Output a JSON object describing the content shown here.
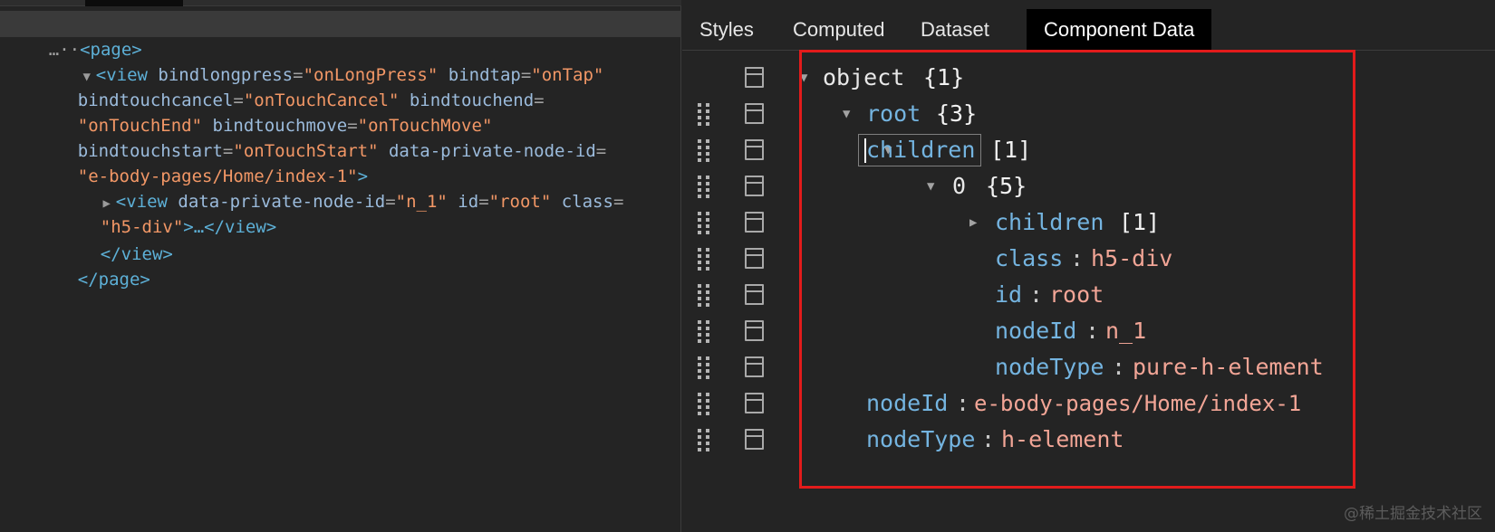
{
  "elements": {
    "lines": [
      {
        "ellipsis": "…",
        "tag_open": "<page>"
      },
      {
        "arrow": "▼",
        "tag_open": "<view ",
        "a1": "bindlongpress",
        "v1": "\"onLongPress\"",
        "a2": "bindtap",
        "v2": "\"onTap\""
      },
      {
        "a1": "bindtouchcancel",
        "v1": "\"onTouchCancel\"",
        "a2": "bindtouchend"
      },
      {
        "v1": "\"onTouchEnd\"",
        "a1": "bindtouchmove",
        "v2": "\"onTouchMove\""
      },
      {
        "a1": "bindtouchstart",
        "v1": "\"onTouchStart\"",
        "a2": "data-private-node-id"
      },
      {
        "v1": "\"e-body-pages/Home/index-1\"",
        "close": ">"
      },
      {
        "arrow": "▶",
        "tag_open": "<view ",
        "a1": "data-private-node-id",
        "v1": "\"n_1\"",
        "a2": "id",
        "v2": "\"root\"",
        "a3": "class"
      },
      {
        "v1": "\"h5-div\"",
        "rest": ">…</view>"
      },
      {
        "tag": "</view>"
      },
      {
        "tag": "</page>"
      }
    ]
  },
  "sidebar": {
    "tabs": [
      "Styles",
      "Computed",
      "Dataset",
      "Component Data"
    ],
    "active_tab": "Component Data",
    "tree": [
      {
        "arrow": "▼",
        "key": "object",
        "count": "{1}"
      },
      {
        "arrow": "▼",
        "key": "root",
        "count": "{3}"
      },
      {
        "arrow": "▼",
        "key": "children",
        "count": "[1]"
      },
      {
        "arrow": "▼",
        "key": "0",
        "count": "{5}"
      },
      {
        "arrow": "▶",
        "key": "children",
        "count": "[1]"
      },
      {
        "key": "class",
        "sep": ":",
        "value": "h5-div"
      },
      {
        "key": "id",
        "sep": ":",
        "value": "root"
      },
      {
        "key": "nodeId",
        "sep": ":",
        "value": "n_1"
      },
      {
        "key": "nodeType",
        "sep": ":",
        "value": "pure-h-element"
      },
      {
        "key": "nodeId",
        "sep": ":",
        "value": "e-body-pages/Home/index-1"
      },
      {
        "key": "nodeType",
        "sep": ":",
        "value": "h-element"
      }
    ]
  },
  "watermark": "@稀土掘金技术社区",
  "colors": {
    "highlight_box": "#e21b1b",
    "tag": "#5db0d7",
    "string": "#f29766",
    "key": "#74b4e0"
  }
}
